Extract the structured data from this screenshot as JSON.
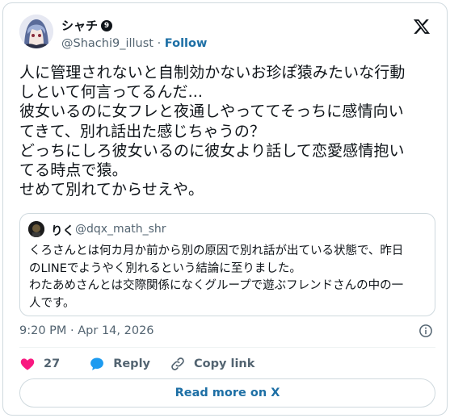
{
  "author": {
    "display_name": "シャチ",
    "badge": "9",
    "handle": "@Shachi9_illust",
    "separator": "·",
    "follow_label": "Follow"
  },
  "tweet": {
    "text": "人に管理されないと自制効かないお珍ぽ猿みたいな行動\nしといて何言ってるんだ...\n彼女いるのに女フレと夜通しやっててそっちに感情向い\nてきて、別れ話出た感じちゃうの？\nどっちにしろ彼女いるのに彼女より話して恋愛感情抱い\nてる時点で猿。\nせめて別れてからせえや。"
  },
  "quoted": {
    "display_name": "りく",
    "handle": "@dqx_math_shr",
    "text": "くろさんとは何カ月か前から別の原因で別れ話が出ている状態で、昨日\nのLINEでようやく別れるという結論に至りました。\nわたあめさんとは交際関係になくグループで遊ぶフレンドさんの中の一\n人です。"
  },
  "timestamp": "9:20 PM · Apr 14, 2026",
  "actions": {
    "like_count": "27",
    "reply_label": "Reply",
    "copy_label": "Copy link"
  },
  "read_more_label": "Read more on X",
  "colors": {
    "like": "#f91880",
    "reply": "#1d9bf0",
    "link": "#1d6fa5",
    "secondary_text": "#536471",
    "border": "#cfd9de"
  },
  "icons": [
    "x-logo-icon",
    "info-icon",
    "heart-icon",
    "reply-bubble-icon",
    "link-icon"
  ]
}
